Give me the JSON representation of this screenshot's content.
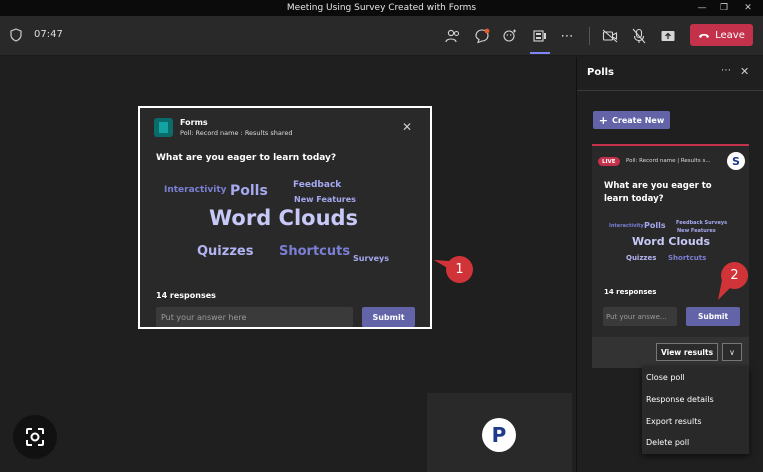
{
  "window": {
    "title": "Meeting Using Survey Created with Forms"
  },
  "toolbar": {
    "timer": "07:47",
    "leave_label": "Leave",
    "icons": [
      "shield-icon",
      "people-icon",
      "chat-icon",
      "reactions-icon",
      "apps-icon",
      "more-icon",
      "camera-off-icon",
      "mic-off-icon",
      "share-icon"
    ]
  },
  "poll_card": {
    "app_name": "Forms",
    "subtitle": "Poll: Record name : Results shared",
    "question": "What are you eager to learn today?",
    "words": [
      "Interactivity",
      "Polls",
      "Feedback",
      "New Features",
      "Word Clouds",
      "Quizzes",
      "Shortcuts",
      "Surveys"
    ],
    "responses": "14 responses",
    "input_placeholder": "Put your answer here",
    "submit_label": "Submit"
  },
  "annotations": {
    "badge_1": "1",
    "badge_2": "2"
  },
  "side_panel": {
    "title": "Polls",
    "create_label": "Create New",
    "card": {
      "live_label": "LIVE",
      "poll_name": "Poll: Record name | Results s...",
      "question": "What are you eager to learn today?",
      "words": [
        "Interactivity",
        "Polls",
        "Feedback Surveys",
        "New Features",
        "Word Clouds",
        "Quizzes",
        "Shortcuts"
      ],
      "responses": "14 responses",
      "input_placeholder": "Put your answe...",
      "submit_label": "Submit",
      "view_results_label": "View results"
    }
  },
  "menu": {
    "items": [
      "Close poll",
      "Response details",
      "Export results",
      "Delete poll"
    ]
  },
  "participant": {
    "initial": "P"
  },
  "colors": {
    "accent": "#6264a7",
    "leave": "#c4314b",
    "live": "#c4314b",
    "badge": "#d13438"
  }
}
